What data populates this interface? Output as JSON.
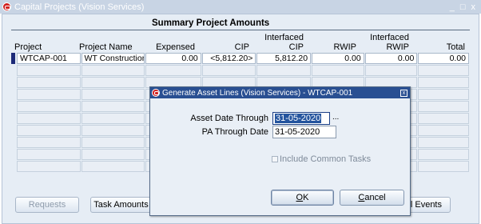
{
  "window": {
    "title": "Capital Projects (Vision Services)",
    "controls": [
      "_",
      "□",
      "x"
    ]
  },
  "summary": {
    "title": "Summary Project Amounts",
    "columns": [
      {
        "line1": "",
        "line2": "Project"
      },
      {
        "line1": "",
        "line2": "Project Name"
      },
      {
        "line1": "",
        "line2": "Expensed"
      },
      {
        "line1": "",
        "line2": "CIP"
      },
      {
        "line1": "Interfaced",
        "line2": "CIP"
      },
      {
        "line1": "",
        "line2": "RWIP"
      },
      {
        "line1": "Interfaced",
        "line2": "RWIP"
      },
      {
        "line1": "",
        "line2": "Total"
      }
    ],
    "rows": [
      [
        "WTCAP-001",
        "WT Construction P",
        "0.00",
        "<5,812.20>",
        "5,812.20",
        "0.00",
        "0.00",
        "0.00"
      ]
    ]
  },
  "buttons": {
    "requests": "Requests",
    "task_amounts": "Task Amounts",
    "capital_events_partial": "tal Events"
  },
  "dialog": {
    "title": "Generate Asset Lines (Vision Services) - WTCAP-001",
    "asset_date_label": "Asset Date Through",
    "asset_date_value": "31-05-2020",
    "pa_date_label": "PA Through Date",
    "pa_date_value": "31-05-2020",
    "include_common_tasks": "Include Common Tasks",
    "include_common_tasks_checked": false,
    "ok_label": "OK",
    "ok_mnemonic": "O",
    "ok_rest": "K",
    "cancel_label": "Cancel",
    "cancel_mnemonic": "C",
    "cancel_rest": "ancel",
    "lov_glyph": "..."
  }
}
